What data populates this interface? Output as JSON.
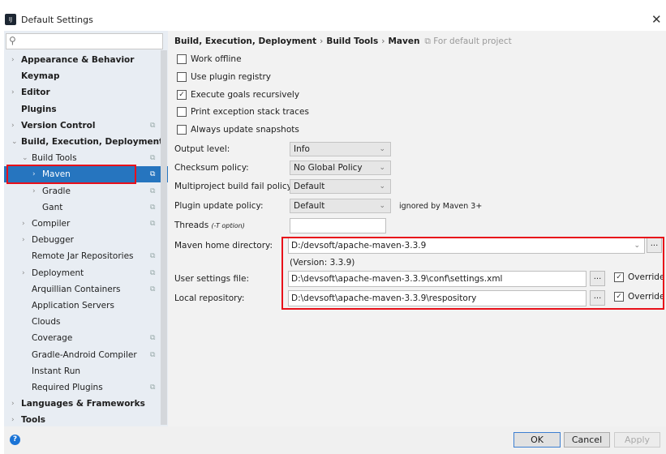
{
  "window": {
    "title": "Default Settings",
    "close": "✕"
  },
  "search": {
    "placeholder": ""
  },
  "tree": [
    {
      "label": "Appearance & Behavior",
      "level": 0,
      "bold": true,
      "arrow": "›",
      "copy": false
    },
    {
      "label": "Keymap",
      "level": 0,
      "bold": true,
      "arrow": "",
      "copy": false
    },
    {
      "label": "Editor",
      "level": 0,
      "bold": true,
      "arrow": "›",
      "copy": false
    },
    {
      "label": "Plugins",
      "level": 0,
      "bold": true,
      "arrow": "",
      "copy": false
    },
    {
      "label": "Version Control",
      "level": 0,
      "bold": true,
      "arrow": "›",
      "copy": true
    },
    {
      "label": "Build, Execution, Deployment",
      "level": 0,
      "bold": true,
      "arrow": "⌄",
      "copy": false
    },
    {
      "label": "Build Tools",
      "level": 1,
      "bold": false,
      "arrow": "⌄",
      "copy": true
    },
    {
      "label": "Maven",
      "level": 2,
      "bold": false,
      "arrow": "›",
      "copy": true,
      "selected": true
    },
    {
      "label": "Gradle",
      "level": 2,
      "bold": false,
      "arrow": "›",
      "copy": true
    },
    {
      "label": "Gant",
      "level": 2,
      "bold": false,
      "arrow": "",
      "copy": true
    },
    {
      "label": "Compiler",
      "level": 1,
      "bold": false,
      "arrow": "›",
      "copy": true
    },
    {
      "label": "Debugger",
      "level": 1,
      "bold": false,
      "arrow": "›",
      "copy": false
    },
    {
      "label": "Remote Jar Repositories",
      "level": 1,
      "bold": false,
      "arrow": "",
      "copy": true
    },
    {
      "label": "Deployment",
      "level": 1,
      "bold": false,
      "arrow": "›",
      "copy": true
    },
    {
      "label": "Arquillian Containers",
      "level": 1,
      "bold": false,
      "arrow": "",
      "copy": true
    },
    {
      "label": "Application Servers",
      "level": 1,
      "bold": false,
      "arrow": "",
      "copy": false
    },
    {
      "label": "Clouds",
      "level": 1,
      "bold": false,
      "arrow": "",
      "copy": false
    },
    {
      "label": "Coverage",
      "level": 1,
      "bold": false,
      "arrow": "",
      "copy": true
    },
    {
      "label": "Gradle-Android Compiler",
      "level": 1,
      "bold": false,
      "arrow": "",
      "copy": true
    },
    {
      "label": "Instant Run",
      "level": 1,
      "bold": false,
      "arrow": "",
      "copy": false
    },
    {
      "label": "Required Plugins",
      "level": 1,
      "bold": false,
      "arrow": "",
      "copy": true
    },
    {
      "label": "Languages & Frameworks",
      "level": 0,
      "bold": true,
      "arrow": "›",
      "copy": false
    },
    {
      "label": "Tools",
      "level": 0,
      "bold": true,
      "arrow": "›",
      "copy": false
    }
  ],
  "breadcrumb": {
    "items": [
      "Build, Execution, Deployment",
      "Build Tools",
      "Maven"
    ],
    "sep": "›",
    "hint": "For default project"
  },
  "checkboxes": [
    {
      "label": "Work offline",
      "checked": false
    },
    {
      "label": "Use plugin registry",
      "checked": false
    },
    {
      "label": "Execute goals recursively",
      "checked": true
    },
    {
      "label": "Print exception stack traces",
      "checked": false
    },
    {
      "label": "Always update snapshots",
      "checked": false
    }
  ],
  "fields": {
    "output_level": {
      "label": "Output level:",
      "value": "Info"
    },
    "checksum": {
      "label": "Checksum policy:",
      "value": "No Global Policy"
    },
    "multiproject": {
      "label": "Multiproject build fail policy:",
      "value": "Default"
    },
    "plugin_update": {
      "label": "Plugin update policy:",
      "value": "Default",
      "note": "ignored by Maven 3+"
    },
    "threads": {
      "label": "Threads",
      "hint": "(-T option)",
      "value": ""
    },
    "maven_home": {
      "label": "Maven home directory:",
      "value": "D:/devsoft/apache-maven-3.3.9",
      "version": "(Version: 3.3.9)"
    },
    "user_settings": {
      "label": "User settings file:",
      "value": "D:\\devsoft\\apache-maven-3.3.9\\conf\\settings.xml",
      "override": "Override",
      "override_checked": true
    },
    "local_repo": {
      "label": "Local repository:",
      "value": "D:\\devsoft\\apache-maven-3.3.9\\respository",
      "override": "Override",
      "override_checked": true
    }
  },
  "browse": "...",
  "buttons": {
    "ok": "OK",
    "cancel": "Cancel",
    "apply": "Apply",
    "help": "?"
  },
  "colors": {
    "selection": "#2675bf",
    "highlight": "#e8101a"
  }
}
